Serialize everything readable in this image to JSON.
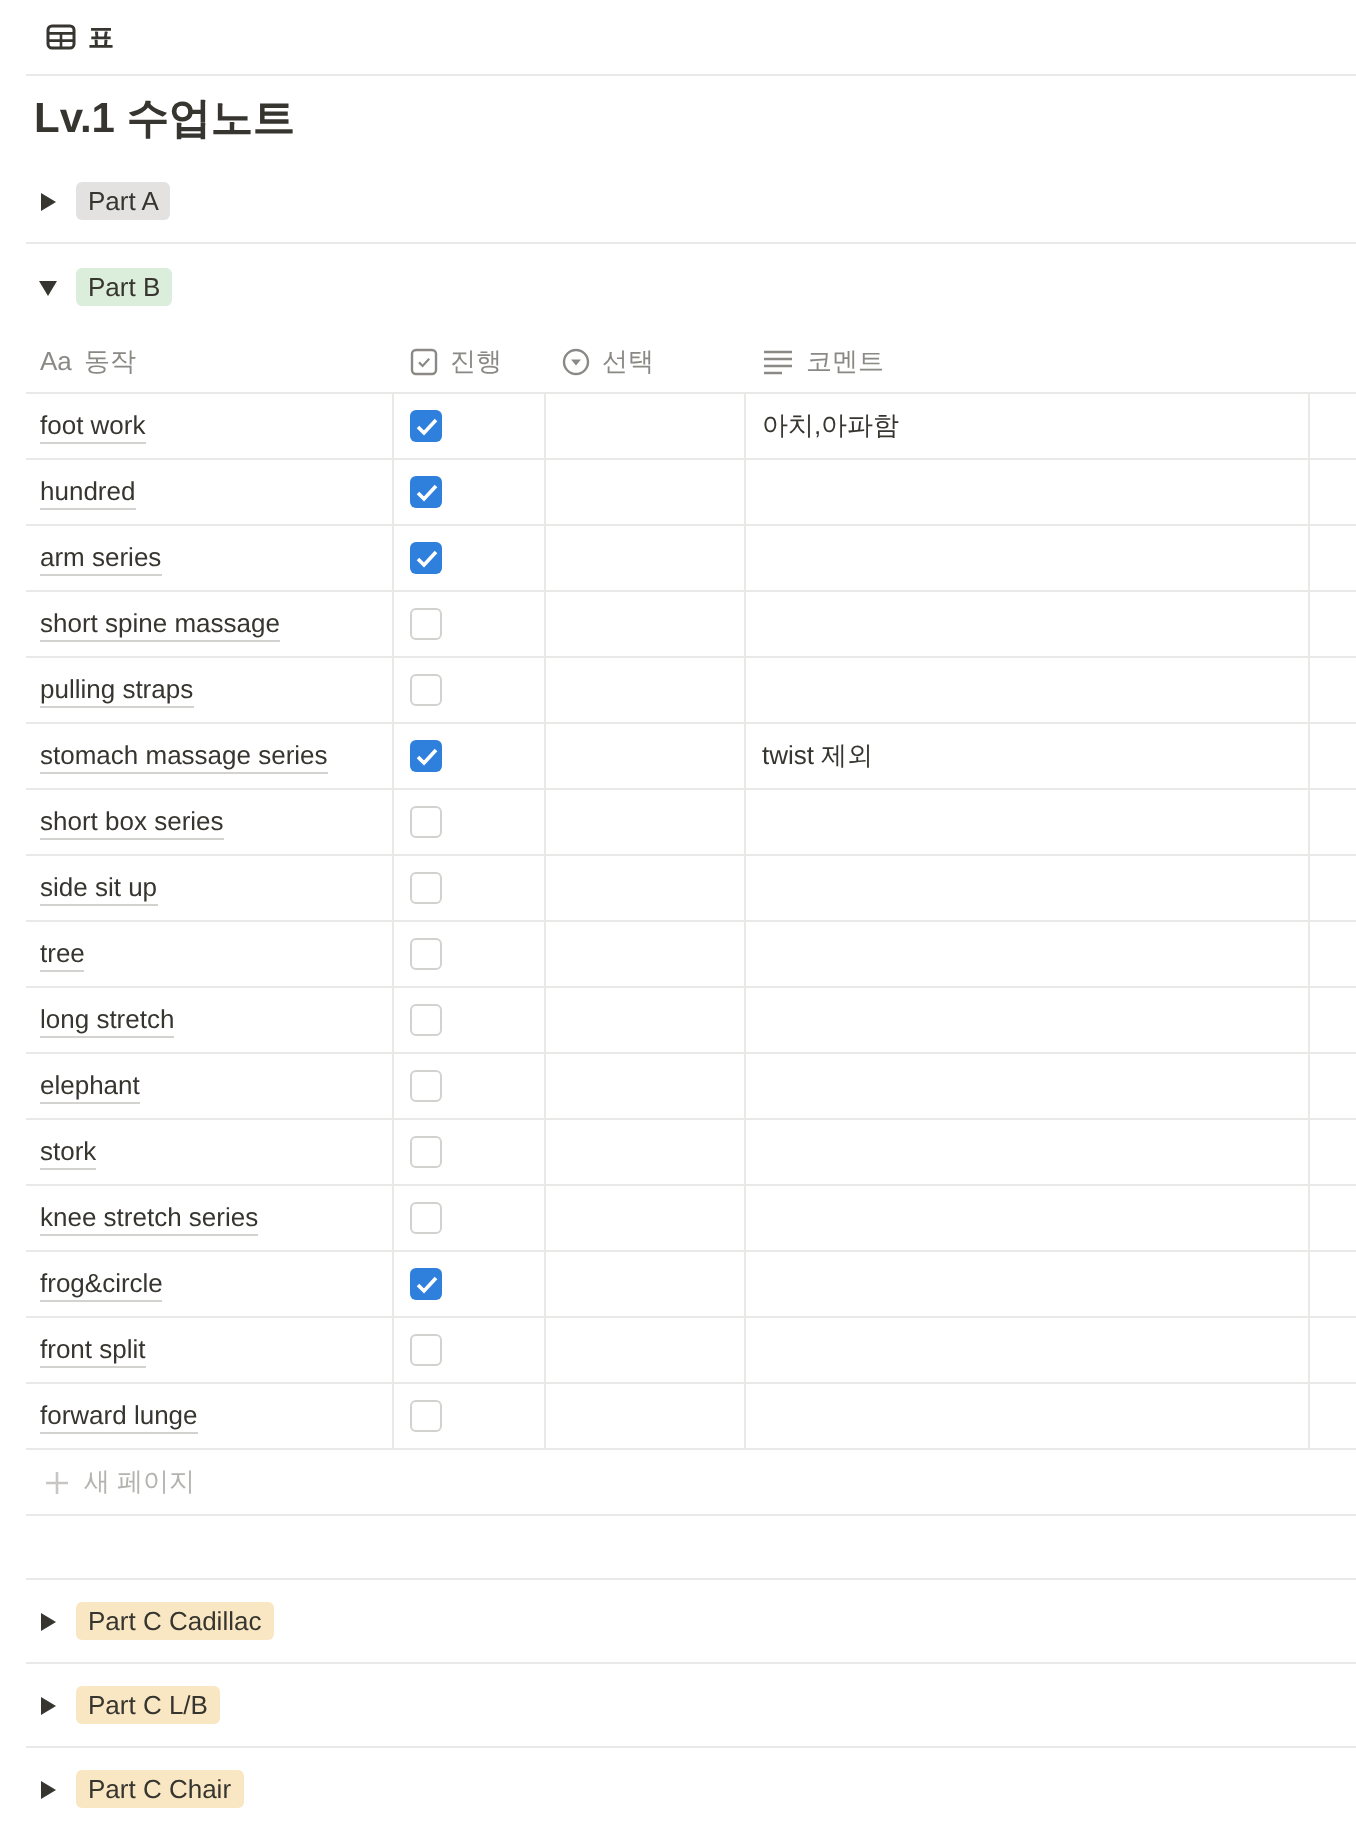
{
  "view_tab": {
    "label": "표"
  },
  "title": "Lv.1 수업노트",
  "columns": [
    {
      "kind": "title",
      "icon_text": "Aa",
      "label": "동작"
    },
    {
      "kind": "checkbox",
      "label": "진행"
    },
    {
      "kind": "select",
      "label": "선택"
    },
    {
      "kind": "text",
      "label": "코멘트"
    }
  ],
  "groups": [
    {
      "label": "Part A",
      "color": "#e3e2e0",
      "expanded": false
    },
    {
      "label": "Part B",
      "color": "#dbeddb",
      "expanded": true,
      "rows": [
        {
          "name": "foot work",
          "checked": true,
          "comment": "아치,아파함"
        },
        {
          "name": "hundred",
          "checked": true
        },
        {
          "name": "arm series",
          "checked": true
        },
        {
          "name": "short spine massage",
          "checked": false
        },
        {
          "name": "pulling straps",
          "checked": false
        },
        {
          "name": "stomach massage series",
          "checked": true,
          "comment": "twist 제외"
        },
        {
          "name": "short box series",
          "checked": false
        },
        {
          "name": "side sit up",
          "checked": false
        },
        {
          "name": "tree",
          "checked": false
        },
        {
          "name": "long stretch",
          "checked": false
        },
        {
          "name": "elephant",
          "checked": false
        },
        {
          "name": "stork",
          "checked": false
        },
        {
          "name": "knee stretch series",
          "checked": false
        },
        {
          "name": "frog&circle",
          "checked": true
        },
        {
          "name": "front split",
          "checked": false
        },
        {
          "name": "forward lunge",
          "checked": false
        }
      ],
      "new_row": "새 페이지"
    },
    {
      "label": "Part C Cadillac",
      "color": "#f8e7c2",
      "expanded": false
    },
    {
      "label": "Part C L/B",
      "color": "#f8e7c2",
      "expanded": false
    },
    {
      "label": "Part C Chair",
      "color": "#f8e7c2",
      "expanded": false
    }
  ]
}
